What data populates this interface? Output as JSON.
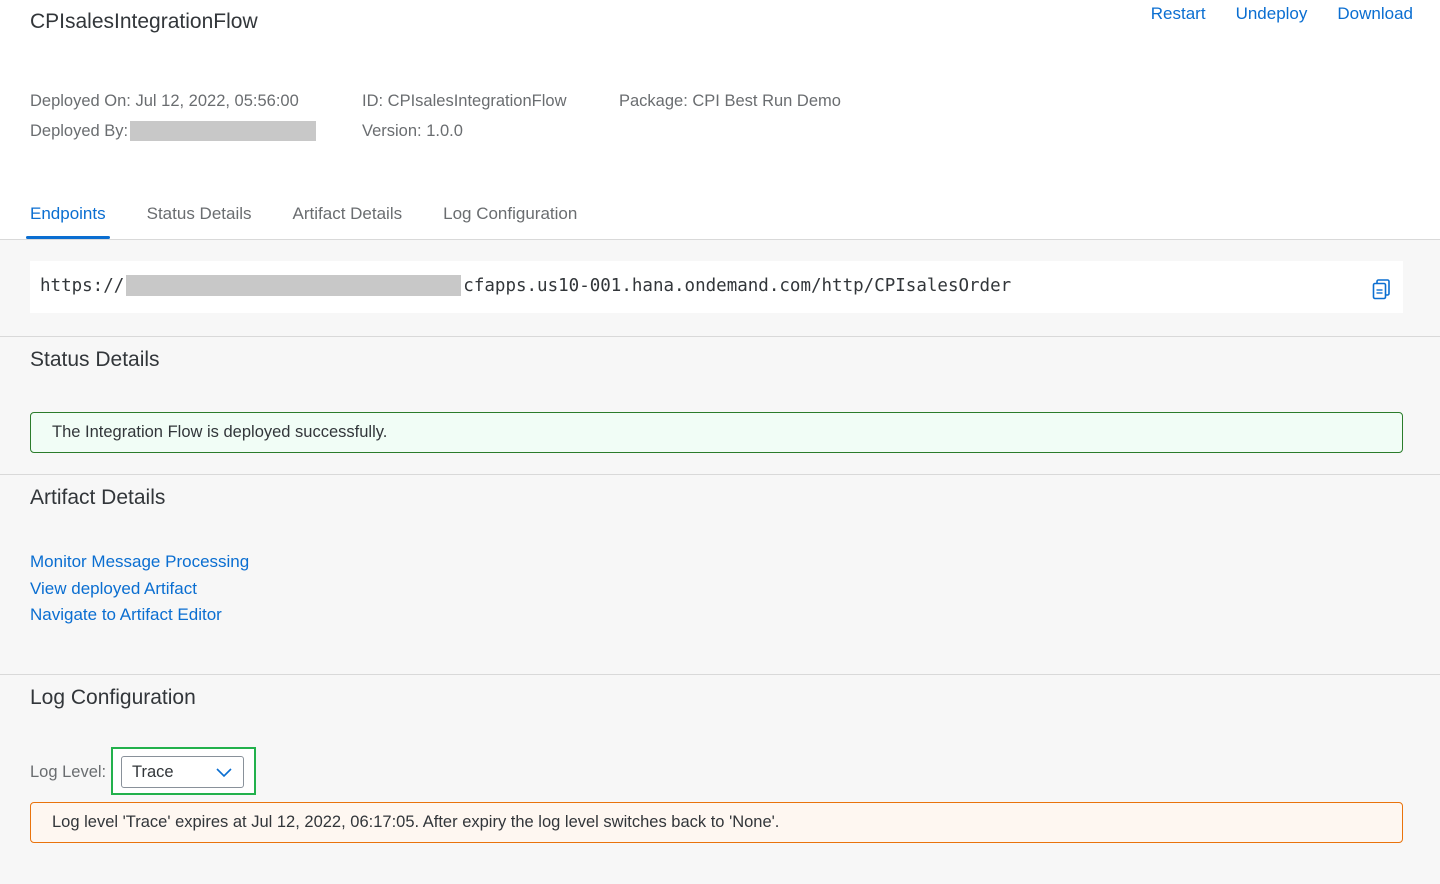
{
  "header": {
    "title": "CPIsalesIntegrationFlow",
    "actions": {
      "restart": "Restart",
      "undeploy": "Undeploy",
      "download": "Download"
    },
    "meta": {
      "deployed_on": "Deployed On: Jul 12, 2022, 05:56:00",
      "deployed_by_label": "Deployed By:",
      "id": "ID: CPIsalesIntegrationFlow",
      "version": "Version: 1.0.0",
      "package": "Package: CPI Best Run Demo"
    },
    "tabs": [
      {
        "label": "Endpoints",
        "active": true
      },
      {
        "label": "Status Details",
        "active": false
      },
      {
        "label": "Artifact Details",
        "active": false
      },
      {
        "label": "Log Configuration",
        "active": false
      }
    ]
  },
  "endpoint": {
    "prefix": "https://",
    "suffix": "cfapps.us10-001.hana.ondemand.com/http/CPIsalesOrder",
    "copy_icon": "copy-icon"
  },
  "status_details": {
    "title": "Status Details",
    "message": "The Integration Flow is deployed successfully."
  },
  "artifact_details": {
    "title": "Artifact Details",
    "links": [
      "Monitor Message Processing",
      "View deployed Artifact",
      "Navigate to Artifact Editor"
    ]
  },
  "log_configuration": {
    "title": "Log Configuration",
    "label": "Log Level:",
    "selected": "Trace",
    "warning": "Log level 'Trace' expires at Jul 12, 2022, 06:17:05. After expiry the log level switches back to 'None'."
  },
  "colors": {
    "accent": "#0a6ed1",
    "success_border": "#2b7c2b",
    "warning_border": "#e9730c",
    "highlight": "#22b14c"
  }
}
